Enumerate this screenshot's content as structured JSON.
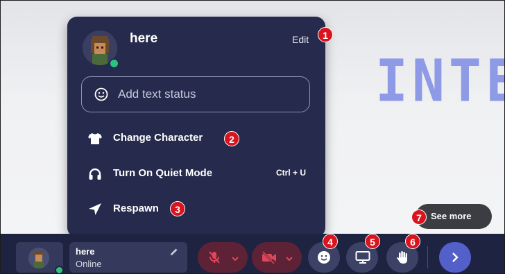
{
  "popup": {
    "username": "here",
    "edit_label": "Edit",
    "status_placeholder": "Add text status",
    "menu": [
      {
        "label": "Change Character",
        "icon": "tshirt-icon"
      },
      {
        "label": "Turn On Quiet Mode",
        "icon": "headphones-icon",
        "shortcut": "Ctrl + U"
      },
      {
        "label": "Respawn",
        "icon": "location-arrow-icon"
      }
    ]
  },
  "background": {
    "banner_text": "INTE"
  },
  "tooltip": {
    "label": "See more"
  },
  "bottom_bar": {
    "user_name": "here",
    "user_status": "Online",
    "mic_muted": true,
    "camera_off": true
  },
  "callouts": [
    "1",
    "2",
    "3",
    "4",
    "5",
    "6",
    "7"
  ],
  "colors": {
    "panel": "#262a4c",
    "bar": "#1f2342",
    "accent": "#5460c9",
    "muted_red": "#5e2237",
    "online": "#2ec27e",
    "callout": "#d8141f"
  }
}
